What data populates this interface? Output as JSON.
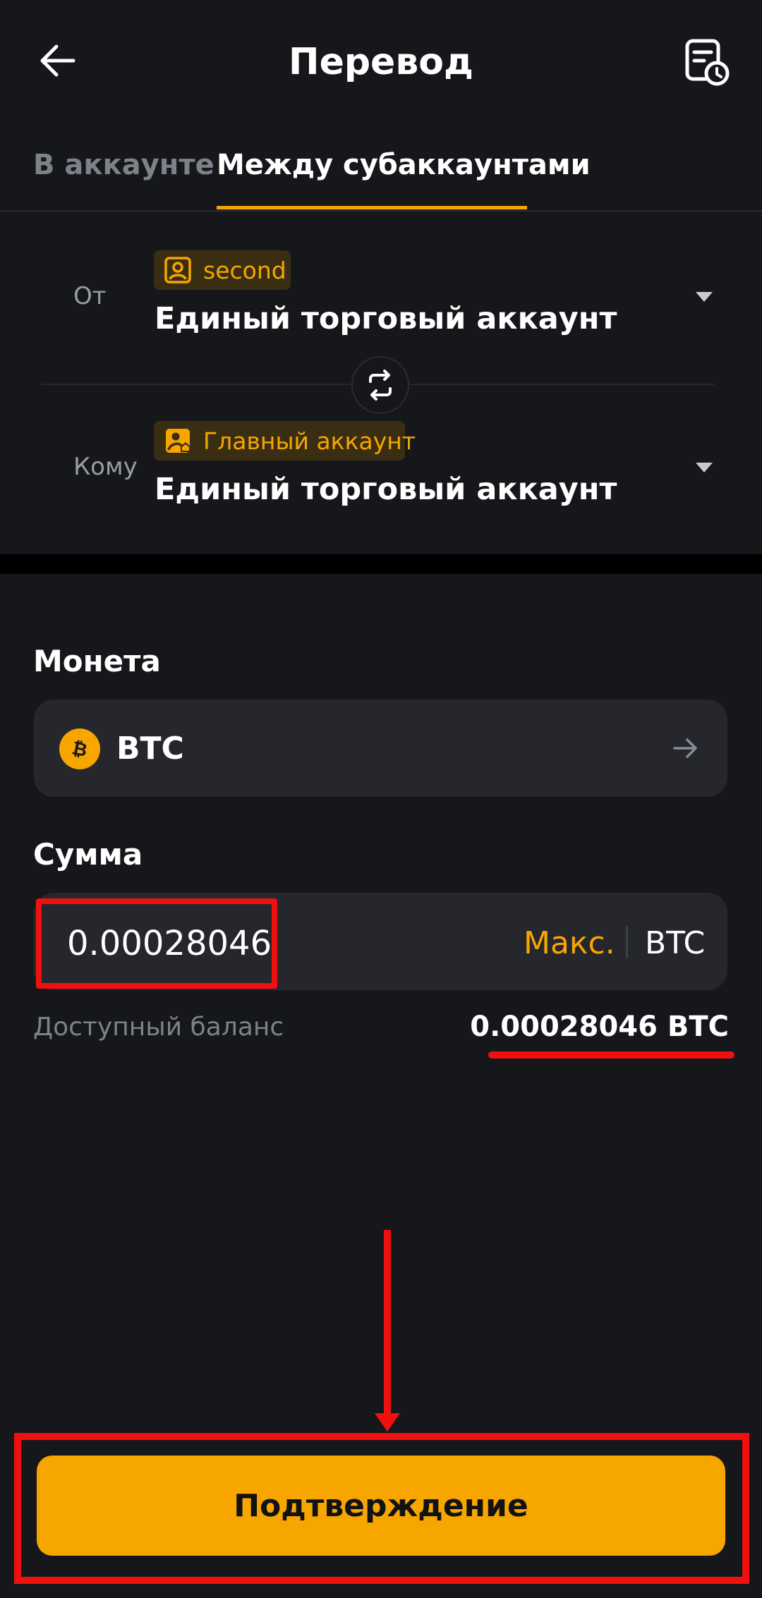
{
  "header": {
    "title": "Перевод",
    "back_icon": "arrow-left-icon",
    "history_icon": "history-document-icon"
  },
  "tabs": [
    {
      "label": "В аккаунте",
      "active": false
    },
    {
      "label": "Между субаккаунтами",
      "active": true
    }
  ],
  "transfer": {
    "from": {
      "label": "От",
      "badge": "second",
      "badge_icon": "user-account-icon",
      "account": "Единый торговый аккаунт"
    },
    "to": {
      "label": "Кому",
      "badge": "Главный аккаунт",
      "badge_icon": "main-account-icon",
      "account": "Единый торговый аккаунт"
    },
    "swap_icon": "swap-arrows-icon"
  },
  "coin": {
    "label": "Монета",
    "value": "BTC",
    "icon": "bitcoin-icon"
  },
  "amount": {
    "label": "Сумма",
    "value": "0.00028046",
    "max_label": "Макс.",
    "unit": "BTC"
  },
  "balance": {
    "label": "Доступный баланс",
    "value": "0.00028046 BTC"
  },
  "confirm_label": "Подтверждение",
  "colors": {
    "background": "#16171b",
    "accent": "#f7a600",
    "field_bg": "#25272d",
    "annotation": "#f01010"
  }
}
